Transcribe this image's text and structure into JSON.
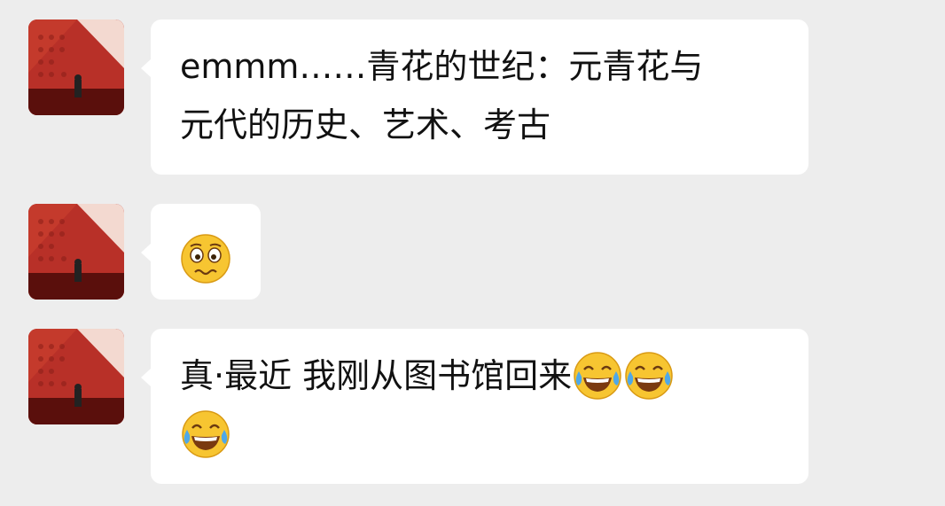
{
  "conversation": {
    "messages": [
      {
        "sender": "other",
        "avatar_icon": "user-avatar-photo",
        "text": "emmm……青花的世纪：元青花与\n元代的历史、艺术、考古"
      },
      {
        "sender": "other",
        "avatar_icon": "user-avatar-photo",
        "emoji": "awkward-face-icon"
      },
      {
        "sender": "other",
        "avatar_icon": "user-avatar-photo",
        "text": "真·最近 我刚从图书馆回来",
        "trailing_emojis": [
          "tears-of-joy-icon",
          "tears-of-joy-icon",
          "tears-of-joy-icon"
        ]
      }
    ]
  },
  "colors": {
    "background": "#ededed",
    "bubble": "#ffffff",
    "text": "#111111",
    "avatar_red": "#b83028",
    "emoji_yellow": "#f7c531"
  }
}
